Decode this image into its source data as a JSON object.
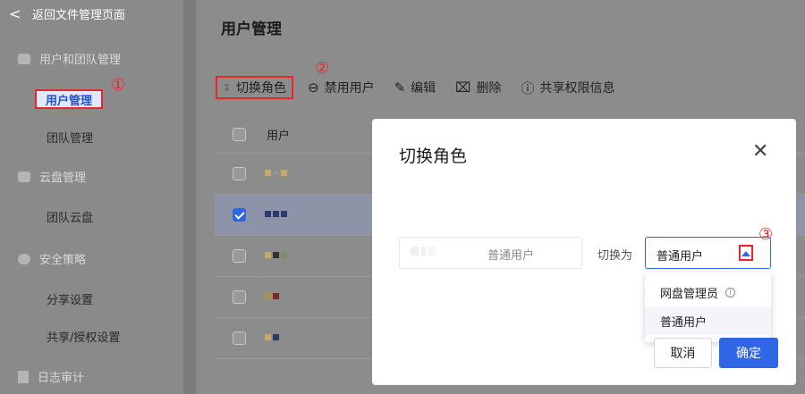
{
  "sidebar": {
    "back_label": "返回文件管理页面",
    "items": [
      {
        "label": "用户和团队管理"
      },
      {
        "label": "用户管理"
      },
      {
        "label": "团队管理"
      },
      {
        "label": "云盘管理"
      },
      {
        "label": "团队云盘"
      },
      {
        "label": "安全策略"
      },
      {
        "label": "分享设置"
      },
      {
        "label": "共享/授权设置"
      },
      {
        "label": "日志审计"
      }
    ]
  },
  "annotations": [
    "①",
    "②",
    "③"
  ],
  "page": {
    "title": "用户管理"
  },
  "toolbar": {
    "switch_role": "切换角色",
    "disable_user": "禁用用户",
    "edit": "编辑",
    "delete": "删除",
    "share_info": "共享权限信息"
  },
  "table": {
    "header_user": "用户",
    "selected_row_suffix": "."
  },
  "modal": {
    "title": "切换角色",
    "current_role": "普通用户",
    "switch_to_label": "切换为",
    "selected_value": "普通用户",
    "options": [
      "网盘管理员",
      "普通用户"
    ],
    "cancel": "取消",
    "confirm": "确定"
  },
  "colors": {
    "accent": "#2f66e6",
    "annotation_red": "#e8262a"
  }
}
